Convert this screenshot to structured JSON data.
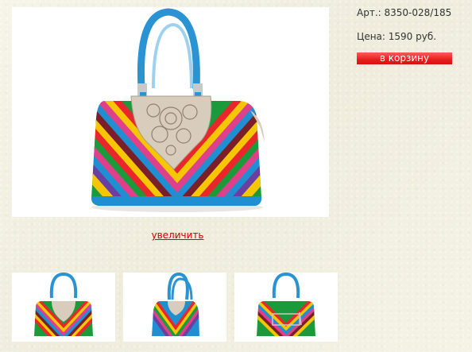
{
  "product": {
    "article_label": "Арт.:",
    "article_value": "8350-028/185",
    "price_label": "Цена:",
    "price_value": "1590 руб.",
    "cart_button_label": "в корзину",
    "zoom_link_label": "увеличить"
  },
  "gallery": {
    "main_image": "rainbow-chevron-handbag-front",
    "thumbnails": [
      "rainbow-handbag-front-thumbnail",
      "rainbow-handbag-side-thumbnail",
      "rainbow-handbag-back-thumbnail"
    ]
  },
  "colors": {
    "page_background": "#f3f1e4",
    "link": "#cc0000",
    "cart_button": "#e81d1d",
    "handle": "#2a93d3"
  }
}
